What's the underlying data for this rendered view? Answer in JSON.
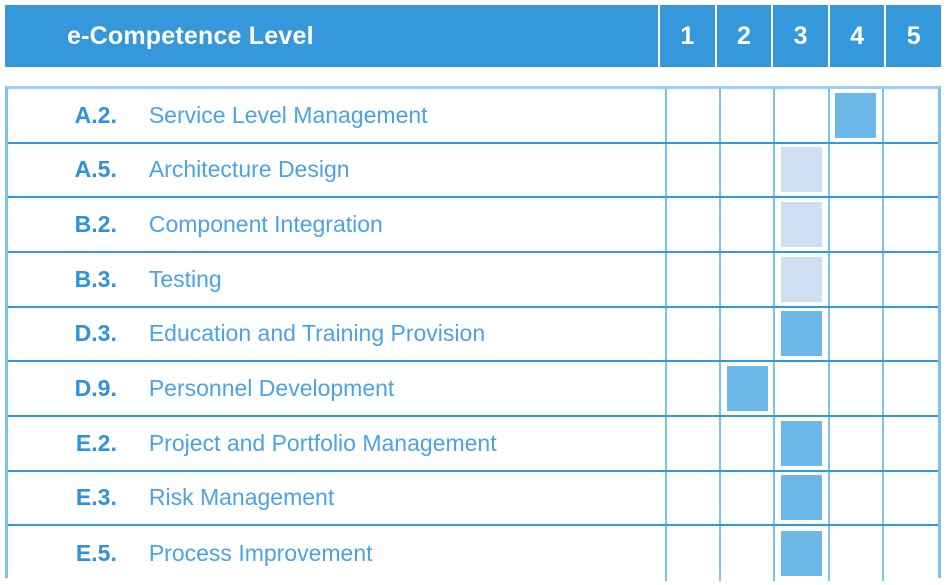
{
  "header": {
    "title": "e-Competence Level",
    "levels": [
      "1",
      "2",
      "3",
      "4",
      "5"
    ]
  },
  "colors": {
    "header_bg": "#3498DB",
    "grid_line": "#7FC0EC",
    "row_line": "#2E9BE0",
    "code_text": "#2E92DC",
    "label_text": "#4BA3E3",
    "fill_strong": "#6CB8E8",
    "fill_light": "#CEDFF4",
    "header_text": "#FFFFFF",
    "background": "#FFFFFF"
  },
  "rows": [
    {
      "code": "A.2.",
      "label": "Service Level Management",
      "marks": [
        "",
        "",
        "",
        "strong",
        ""
      ]
    },
    {
      "code": "A.5.",
      "label": "Architecture Design",
      "marks": [
        "",
        "",
        "light",
        "",
        ""
      ]
    },
    {
      "code": "B.2.",
      "label": "Component Integration",
      "marks": [
        "",
        "",
        "light",
        "",
        ""
      ]
    },
    {
      "code": "B.3.",
      "label": "Testing",
      "marks": [
        "",
        "",
        "light",
        "",
        ""
      ]
    },
    {
      "code": "D.3.",
      "label": "Education and Training Provision",
      "marks": [
        "",
        "",
        "strong",
        "",
        ""
      ]
    },
    {
      "code": "D.9.",
      "label": "Personnel Development",
      "marks": [
        "",
        "strong",
        "",
        "",
        ""
      ]
    },
    {
      "code": "E.2.",
      "label": "Project and Portfolio Management",
      "marks": [
        "",
        "",
        "strong",
        "",
        ""
      ]
    },
    {
      "code": "E.3.",
      "label": "Risk Management",
      "marks": [
        "",
        "",
        "strong",
        "",
        ""
      ]
    },
    {
      "code": "E.5.",
      "label": "Process Improvement",
      "marks": [
        "",
        "",
        "strong",
        "",
        ""
      ]
    }
  ]
}
